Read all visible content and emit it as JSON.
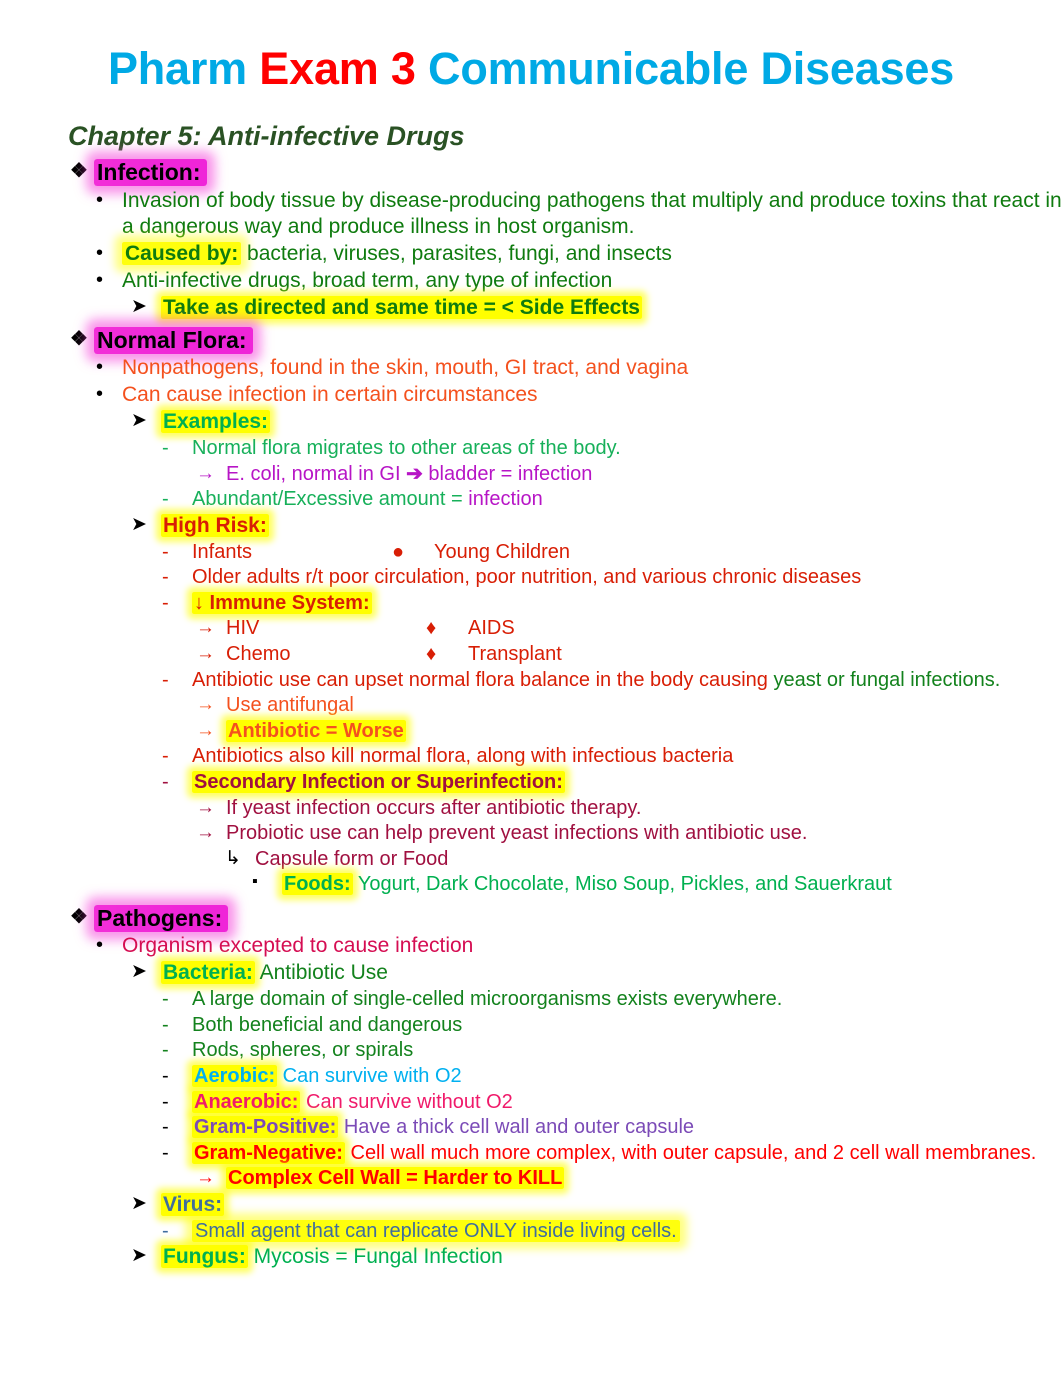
{
  "title": {
    "part1": "Pharm ",
    "part2": "Exam 3",
    "part3": " Communicable Diseases",
    "color_blue": "#00a9e5",
    "color_red": "#ff0000"
  },
  "chapter_heading": "Chapter 5: Anti-infective Drugs",
  "icons": {
    "diamond_outline": "❖",
    "round_bullet": "•",
    "arrow_head": "➤",
    "dash": "-",
    "arrow_right": "→",
    "arrow_bold": "➔",
    "diamond_solid": "♦",
    "square_small": "▪",
    "arrow_down_right": "↳",
    "big_circle": "●",
    "down_arrow": "↓"
  },
  "sections": {
    "infection": {
      "heading": "Infection:",
      "b1": "Invasion of body tissue by disease-producing pathogens that multiply and produce toxins that react in a dangerous way and produce illness in host organism.",
      "b2_label": "Caused by:",
      "b2_text": " bacteria, viruses, parasites, fungi, and insects",
      "b3": "Anti-infective drugs, broad term, any type of infection",
      "b4": "Take as directed and same time = < Side Effects"
    },
    "normal_flora": {
      "heading": "Normal Flora:",
      "b1": "Nonpathogens, found in the skin, mouth, GI tract, and vagina",
      "b2": "Can cause infection in certain circumstances",
      "examples_label": "Examples:",
      "ex1": "Normal flora migrates to other areas of the body.",
      "ex2_a": "E. coli, normal in GI ",
      "ex2_b": " bladder = infection",
      "ex3_a": "Abundant/Excessive amount = ",
      "ex3_b": "infection",
      "high_risk_label": "High Risk:",
      "hr1": "Infants",
      "hr1b": "Young Children",
      "hr2": "Older adults r/t poor circulation, poor nutrition, and various chronic diseases",
      "immune_label": "↓ Immune System:",
      "im1a": "HIV",
      "im1b": "AIDS",
      "im2a": "Chemo",
      "im2b": "Transplant",
      "ab1_a": "Antibiotic use can upset normal flora balance in the body causing ",
      "ab1_b": "yeast or fungal infections.",
      "ab1_sub1": "Use antifungal",
      "ab1_sub2": "Antibiotic = Worse",
      "ab2": "Antibiotics also kill normal flora, along with infectious bacteria",
      "secondary_label": "Secondary Infection or Superinfection:",
      "sec1": "If yeast infection occurs after antibiotic therapy.",
      "sec2": "Probiotic use can help prevent yeast infections with antibiotic use.",
      "sec3": "Capsule form or Food",
      "foods_label": "Foods:",
      "foods_text": " Yogurt, Dark Chocolate, Miso Soup, Pickles, and Sauerkraut"
    },
    "pathogens": {
      "heading": "Pathogens:",
      "b1": "Organism excepted to cause infection",
      "bacteria_label": "Bacteria:",
      "bacteria_text": " Antibiotic Use",
      "bac1": "A large domain of single-celled microorganisms exists everywhere.",
      "bac2": "Both beneficial and dangerous",
      "bac3": "Rods, spheres, or spirals",
      "aerobic_label": "Aerobic:",
      "aerobic_text": " Can survive with O2",
      "anaerobic_label": "Anaerobic:",
      "anaerobic_text": " Can survive without O2",
      "grampos_label": "Gram-Positive:",
      "grampos_text": " Have a thick cell wall and outer capsule",
      "gramneg_label": "Gram-Negative:",
      "gramneg_text": " Cell wall much more complex, with outer capsule, and 2 cell wall membranes.",
      "gramneg_sub": "Complex Cell Wall = Harder to KILL",
      "virus_label": "Virus:",
      "virus_text": "Small agent that can replicate ONLY inside living cells.",
      "fungus_label": "Fungus:",
      "fungus_text": " Mycosis = Fungal Infection"
    }
  }
}
